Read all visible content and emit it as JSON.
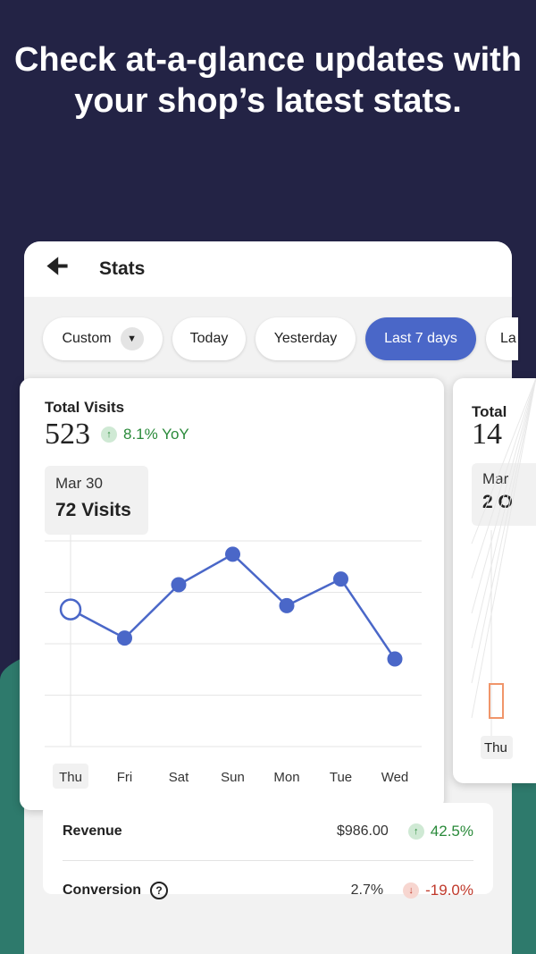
{
  "headline": "Check at-a-glance updates with your shop’s latest stats.",
  "appbar": {
    "title": "Stats",
    "back_icon": "arrow-left-icon"
  },
  "chips": [
    {
      "label": "Custom",
      "dropdown": true
    },
    {
      "label": "Today"
    },
    {
      "label": "Yesterday"
    },
    {
      "label": "Last 7 days",
      "active": true
    },
    {
      "label": "La"
    }
  ],
  "colors": {
    "accent": "#4a67c8",
    "background": "#232345",
    "green_band": "#2e7a6c",
    "positive": "#2a8a3a",
    "negative": "#c0392b"
  },
  "visits_card": {
    "label": "Total Visits",
    "value": "523",
    "change": "8.1% YoY",
    "tooltip": {
      "date": "Mar 30",
      "value": "72 Visits"
    }
  },
  "side_card": {
    "label": "Total",
    "value": "14",
    "tooltip_date": "Mar",
    "tooltip_value": "2 O",
    "x_label": "Thu"
  },
  "chart_data": {
    "type": "line",
    "categories": [
      "Thu",
      "Fri",
      "Sat",
      "Sun",
      "Mon",
      "Tue",
      "Wed"
    ],
    "values": [
      72,
      57,
      85,
      101,
      74,
      88,
      46
    ],
    "ylim": [
      0,
      108
    ],
    "grid": true,
    "selected": "Thu"
  },
  "metrics": [
    {
      "name": "Revenue",
      "value": "$986.00",
      "change": "42.5%",
      "direction": "up"
    },
    {
      "name": "Conversion",
      "value": "2.7%",
      "change": "-19.0%",
      "direction": "down",
      "help_icon": true
    }
  ]
}
